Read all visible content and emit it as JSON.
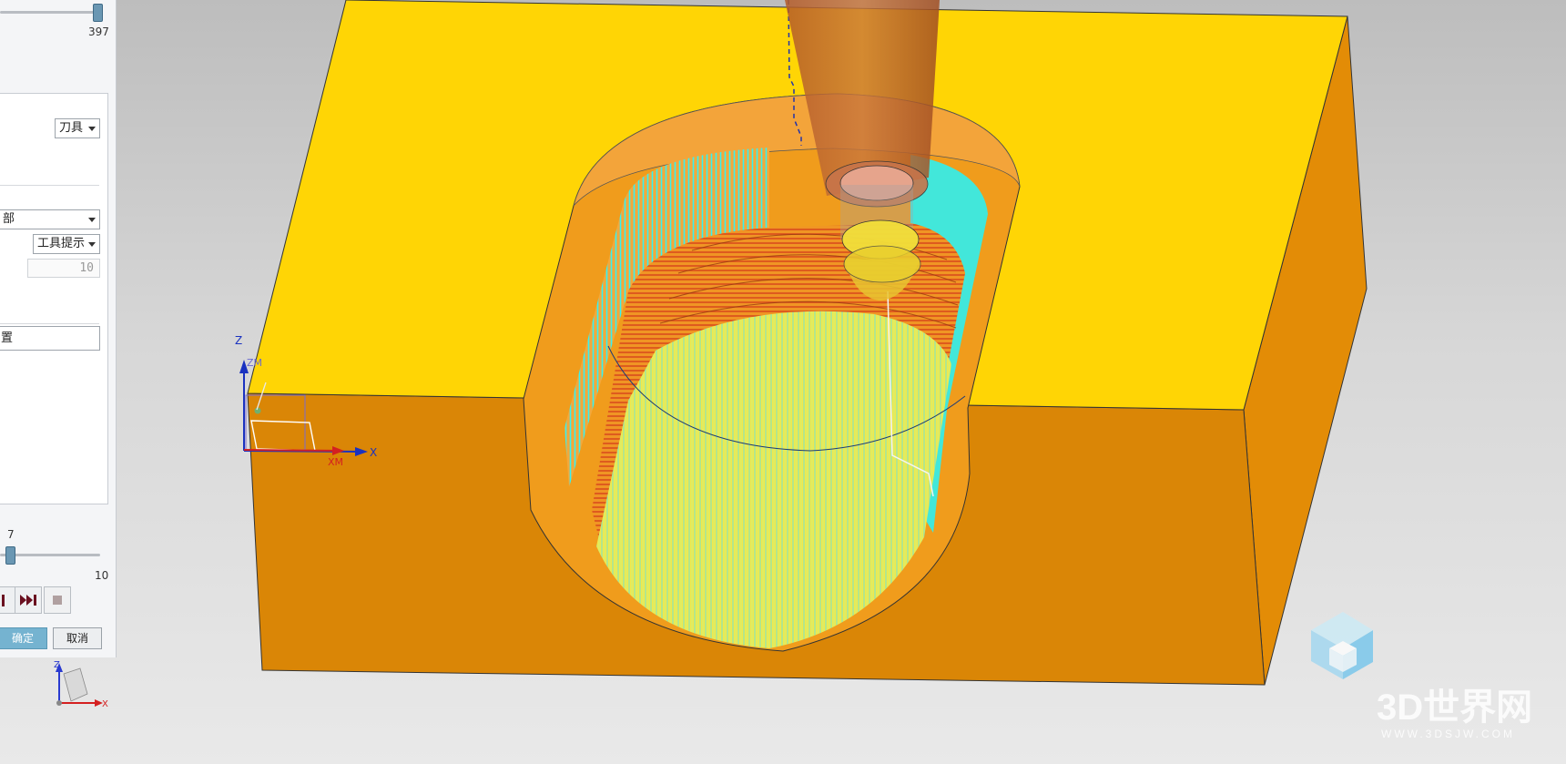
{
  "panel": {
    "animation_speed_value": "397",
    "display_dropdown": "刀具",
    "dropdown_partial": "部",
    "tooltip_dropdown": "工具提示",
    "count_value": "10",
    "text_field_partial": "置",
    "step_current": "7",
    "step_max": "10",
    "ok_label": "确定",
    "cancel_label": "取消"
  },
  "csys": {
    "z_label": "Z",
    "zm_label": "ZM",
    "x_label": "X",
    "xm_label": "XM"
  },
  "triad": {
    "z_label": "Z",
    "x_label": "X"
  },
  "watermark": {
    "brand": "3D世界网",
    "url": "WWW.3DSJW.COM"
  },
  "colors": {
    "block_top": "#ffd505",
    "block_side": "#e08a06",
    "cavity": "#f09b1c",
    "toolpath_cyan": "#2ff0f0",
    "toolpath_yellow": "#d8f05a",
    "toolpath_red": "#d8401a",
    "tool_body": "#b5632d"
  }
}
